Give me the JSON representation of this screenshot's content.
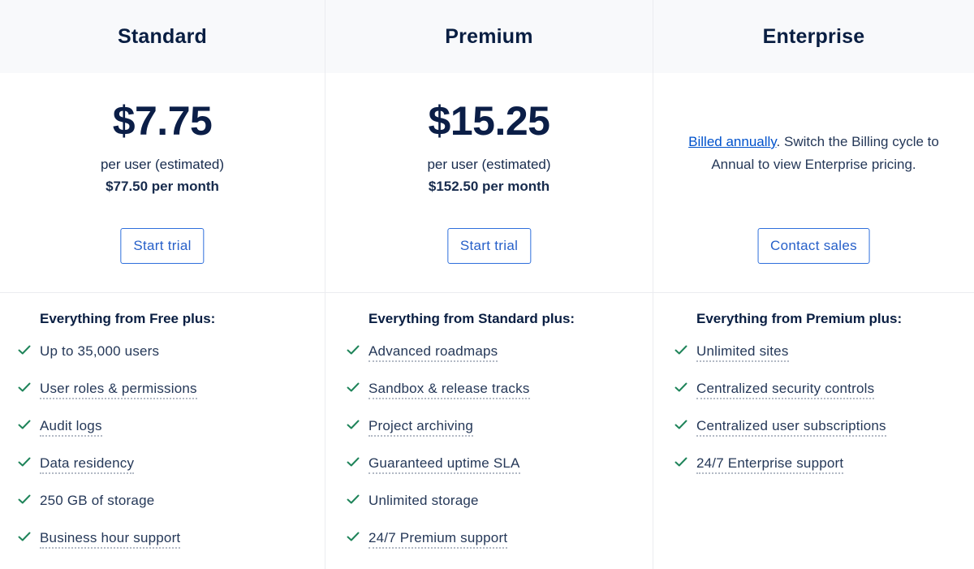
{
  "plans": [
    {
      "name": "Standard",
      "price": "$7.75",
      "per_user": "per user (estimated)",
      "per_month": "$77.50 per month",
      "button": "Start trial",
      "features_title": "Everything from Free plus:",
      "features": [
        {
          "label": "Up to 35,000 users",
          "tooltip": false
        },
        {
          "label": "User roles & permissions",
          "tooltip": true
        },
        {
          "label": "Audit logs",
          "tooltip": true
        },
        {
          "label": "Data residency",
          "tooltip": true
        },
        {
          "label": "250 GB of storage",
          "tooltip": false
        },
        {
          "label": "Business hour support",
          "tooltip": true
        }
      ]
    },
    {
      "name": "Premium",
      "price": "$15.25",
      "per_user": "per user (estimated)",
      "per_month": "$152.50 per month",
      "button": "Start trial",
      "features_title": "Everything from Standard plus:",
      "features": [
        {
          "label": "Advanced roadmaps",
          "tooltip": true
        },
        {
          "label": "Sandbox & release tracks",
          "tooltip": true
        },
        {
          "label": "Project archiving",
          "tooltip": true
        },
        {
          "label": "Guaranteed uptime SLA",
          "tooltip": true
        },
        {
          "label": "Unlimited storage",
          "tooltip": false
        },
        {
          "label": "24/7 Premium support",
          "tooltip": true
        }
      ]
    },
    {
      "name": "Enterprise",
      "note_link": "Billed annually",
      "note_text": ". Switch the Billing cycle to Annual to view Enterprise pricing.",
      "button": "Contact sales",
      "features_title": "Everything from Premium plus:",
      "features": [
        {
          "label": "Unlimited sites",
          "tooltip": true
        },
        {
          "label": "Centralized security controls",
          "tooltip": true
        },
        {
          "label": "Centralized user subscriptions",
          "tooltip": true
        },
        {
          "label": "24/7 Enterprise support",
          "tooltip": true
        }
      ]
    }
  ],
  "icons": {
    "check": "check-icon"
  },
  "colors": {
    "accent": "#0052cc",
    "check": "#1f845a",
    "heading": "#091e42",
    "header_bg": "#f8f9fb"
  }
}
